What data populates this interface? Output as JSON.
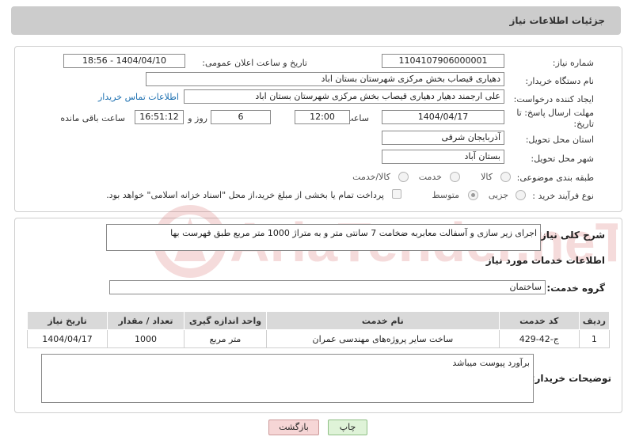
{
  "header": {
    "title": "جزئیات اطلاعات نیاز"
  },
  "fields": {
    "need_number_label": "شماره نیاز:",
    "need_number": "1104107906000001",
    "announce_label": "تاریخ و ساعت اعلان عمومی:",
    "announce_value": "1404/04/10 - 18:56",
    "buyer_org_label": "نام دستگاه خریدار:",
    "buyer_org": "دهیاری قیصاب بخش مرکزی شهرستان بستان اباد",
    "creator_label": "ایجاد کننده درخواست:",
    "creator": "علی ارجمند دهیار دهیاری قیصاب بخش مرکزی شهرستان بستان اباد",
    "contact_link": "اطلاعات تماس خریدار",
    "deadline_label_1": "مهلت ارسال پاسخ: تا",
    "deadline_label_2": "تاریخ:",
    "deadline_date": "1404/04/17",
    "time_label": "ساعت",
    "deadline_time": "12:00",
    "days_value": "6",
    "days_label": "روز و",
    "remaining_time": "16:51:12",
    "remaining_label": "ساعت باقی مانده",
    "province_label": "استان محل تحویل:",
    "province": "آذربایجان شرقی",
    "city_label": "شهر محل تحویل:",
    "city": "بستان آباد",
    "category_label": "طبقه بندی موضوعی:",
    "category_options": [
      "کالا",
      "خدمت",
      "کالا/خدمت"
    ],
    "process_label": "نوع فرآیند خرید :",
    "process_options": [
      "جزیی",
      "متوسط"
    ],
    "payment_note": "پرداخت تمام یا بخشی از مبلغ خرید،از محل \"اسناد خزانه اسلامی\" خواهد بود."
  },
  "summary": {
    "label": "شرح کلی نیاز:",
    "text": "اجرای زیر سازی و آسفالت معابربه ضخامت 7 سانتی متر و  به متراژ 1000 متر مربع طبق فهرست بها"
  },
  "services": {
    "section_title": "اطلاعات خدمات مورد نیاز",
    "group_label": "گروه خدمت:",
    "group_value": "ساختمان",
    "columns": [
      "ردیف",
      "کد خدمت",
      "نام خدمت",
      "واحد اندازه گیری",
      "تعداد / مقدار",
      "تاریخ نیاز"
    ],
    "rows": [
      [
        "1",
        "ج-42-429",
        "ساخت سایر پروژه‌های مهندسی عمران",
        "متر مربع",
        "1000",
        "1404/04/17"
      ]
    ]
  },
  "buyer_notes": {
    "label": "توضیحات خریدار:",
    "text": "برآورد پیوست میباشد"
  },
  "buttons": {
    "print": "چاپ",
    "back": "بازگشت"
  },
  "watermark": {
    "text": "AriaTender.neT"
  },
  "colors": {
    "header_bg": "#cccccc",
    "link": "#1b6fb0",
    "back_button_bg": "#f6d6d6",
    "print_button_bg": "#dff3d8",
    "watermark": "#c62828"
  }
}
